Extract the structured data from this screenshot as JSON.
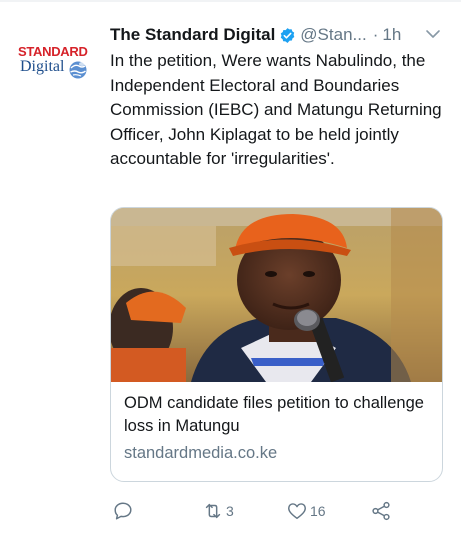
{
  "tweet": {
    "author_name": "The Standard Digital",
    "handle": "@Stan...",
    "separator": "·",
    "time": "1h",
    "text": "In the petition, Were wants Nabulindo, the Independent Electoral and Boundaries Commission (IEBC) and Matungu Returning Officer, John Kiplagat to be held jointly accountable for 'irregularities'.",
    "verified": true
  },
  "avatar": {
    "logo_line1": "STANDARD",
    "logo_line2": "Digital",
    "brand_red": "#d6232a",
    "brand_blue": "#1e4e8c"
  },
  "card": {
    "title": "ODM candidate files petition to challenge loss in Matungu",
    "domain": "standardmedia.co.ke",
    "image_description_icon": "photo-of-man-speaking-at-microphone"
  },
  "actions": {
    "reply_count": "",
    "retweet_count": "3",
    "like_count": "16"
  },
  "colors": {
    "text": "#14171a",
    "muted": "#657786",
    "verified_blue": "#1da1f2",
    "border": "#ccd6dd"
  }
}
